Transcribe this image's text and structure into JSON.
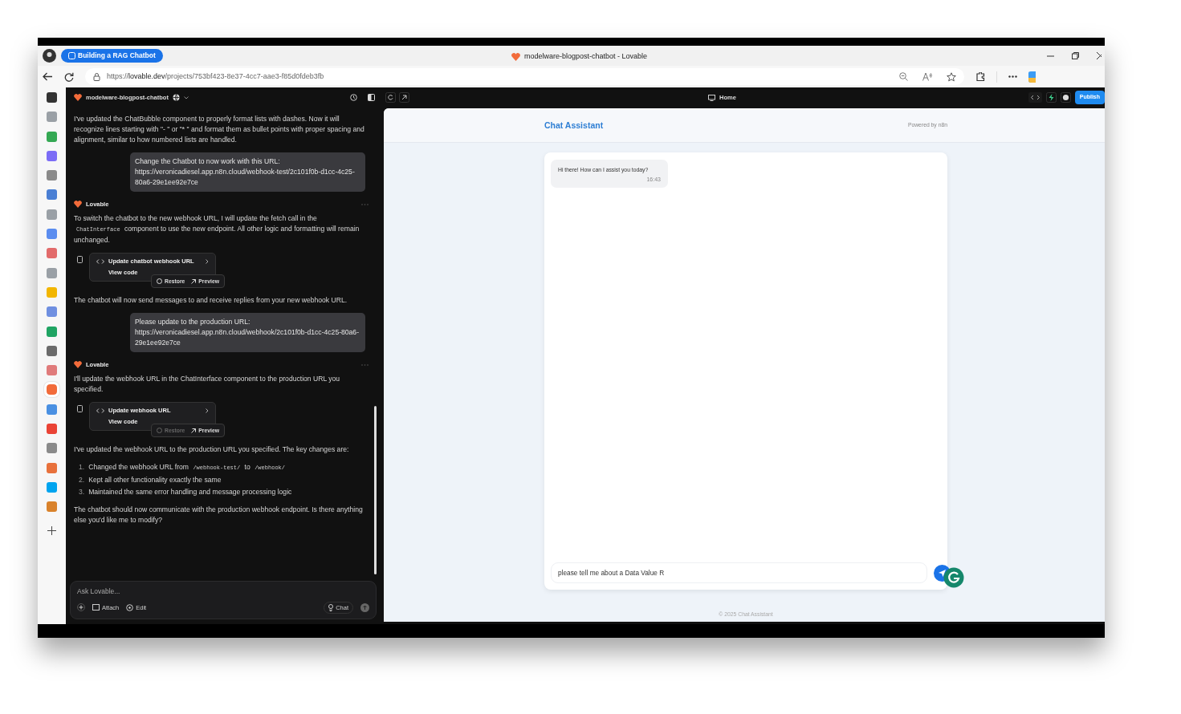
{
  "browser": {
    "tab_group": "Building a RAG Chatbot",
    "title": "modelware-blogpost-chatbot - Lovable",
    "url": {
      "scheme": "https://",
      "host": "lovable.dev",
      "path": "/projects/753bf423-8e37-4cc7-aae3-f85d0fdeb3fb"
    }
  },
  "sidebar_apps": [
    {
      "color": "#333333",
      "selected": false
    },
    {
      "color": "#9aa0a6",
      "selected": false
    },
    {
      "color": "#34a853",
      "selected": false
    },
    {
      "color": "#7b6cf6",
      "selected": false
    },
    {
      "color": "#8a8a8a",
      "selected": false
    },
    {
      "color": "#4a7fd4",
      "selected": false
    },
    {
      "color": "#9aa0a6",
      "selected": false
    },
    {
      "color": "#5b8def",
      "selected": false
    },
    {
      "color": "#e26b6b",
      "selected": false
    },
    {
      "color": "#9aa0a6",
      "selected": false
    },
    {
      "color": "#f2b600",
      "selected": false
    },
    {
      "color": "#6f8fe0",
      "selected": false
    },
    {
      "color": "#1fa463",
      "selected": false
    },
    {
      "color": "#6b6b6b",
      "selected": false
    },
    {
      "color": "#e07b7b",
      "selected": false
    },
    {
      "color": "#f26b3a",
      "selected": true
    },
    {
      "color": "#4a90e2",
      "selected": false
    },
    {
      "color": "#ea4335",
      "selected": false
    },
    {
      "color": "#8a8a8a",
      "selected": false
    },
    {
      "color": "#e8713c",
      "selected": false
    },
    {
      "color": "#00a4ef",
      "selected": false
    },
    {
      "color": "#d9822b",
      "selected": false
    }
  ],
  "project": {
    "name": "modelware-blogpost-chatbot",
    "preview_page": "Home",
    "publish": "Publish"
  },
  "messages": [
    {
      "kind": "text",
      "parts": [
        {
          "text": "I've updated the ChatBubble component to properly format lists with dashes. Now it will recognize lines starting with \"- \" or \"* \" and format them as bullet points with proper spacing and alignment, similar to how numbered lists are handled.",
          "code": false
        }
      ]
    },
    {
      "kind": "user",
      "text": "Change the Chatbot to now work with this URL: https://veronicadiesel.app.n8n.cloud/webhook-test/2c101f0b-d1cc-4c25-80a6-29e1ee92e7ce"
    },
    {
      "kind": "author",
      "text": "Lovable"
    },
    {
      "kind": "text",
      "parts": [
        {
          "text": "To switch the chatbot to the new webhook URL, I will update the fetch call in the ",
          "code": false
        },
        {
          "text": "ChatInterface",
          "code": true
        },
        {
          "text": " component to use the new endpoint. All other logic and formatting will remain unchanged.",
          "code": false
        }
      ]
    },
    {
      "kind": "card",
      "title": "Update chatbot webhook URL",
      "link": "View code",
      "restore": "Restore",
      "preview": "Preview",
      "restore_disabled": false
    },
    {
      "kind": "text",
      "parts": [
        {
          "text": "The chatbot will now send messages to and receive replies from your new webhook URL.",
          "code": false
        }
      ]
    },
    {
      "kind": "user",
      "text": "Please update to the production URL: https://veronicadiesel.app.n8n.cloud/webhook/2c101f0b-d1cc-4c25-80a6-29e1ee92e7ce"
    },
    {
      "kind": "author",
      "text": "Lovable"
    },
    {
      "kind": "text",
      "parts": [
        {
          "text": "I'll update the webhook URL in the ChatInterface component to the production URL you specified.",
          "code": false
        }
      ]
    },
    {
      "kind": "card",
      "title": "Update webhook URL",
      "link": "View code",
      "restore": "Restore",
      "preview": "Preview",
      "restore_disabled": true
    },
    {
      "kind": "text",
      "parts": [
        {
          "text": "I've updated the webhook URL to the production URL you specified. The key changes are:",
          "code": false
        }
      ]
    },
    {
      "kind": "list",
      "items": [
        {
          "number": "1.",
          "parts": [
            {
              "text": "Changed the webhook URL from ",
              "code": false
            },
            {
              "text": "/webhook-test/",
              "code": true
            },
            {
              "text": " to ",
              "code": false
            },
            {
              "text": "/webhook/",
              "code": true
            }
          ]
        },
        {
          "number": "2.",
          "parts": [
            {
              "text": "Kept all other functionality exactly the same",
              "code": false
            }
          ]
        },
        {
          "number": "3.",
          "parts": [
            {
              "text": "Maintained the same error handling and message processing logic",
              "code": false
            }
          ]
        }
      ]
    },
    {
      "kind": "text",
      "parts": [
        {
          "text": "The chatbot should now communicate with the production webhook endpoint. Is there anything else you'd like me to modify?",
          "code": false
        }
      ]
    }
  ],
  "composer": {
    "placeholder": "Ask Lovable...",
    "attach": "Attach",
    "edit": "Edit",
    "mode": "Chat"
  },
  "preview": {
    "title": "Chat Assistant",
    "powered_by": "Powered by n8n",
    "messages": [
      {
        "text": "Hi there! How can I assist you today?",
        "time": "16:43"
      }
    ],
    "input_value": "please tell me about a Data Value R",
    "footer": "© 2025 Chat Assistant"
  }
}
